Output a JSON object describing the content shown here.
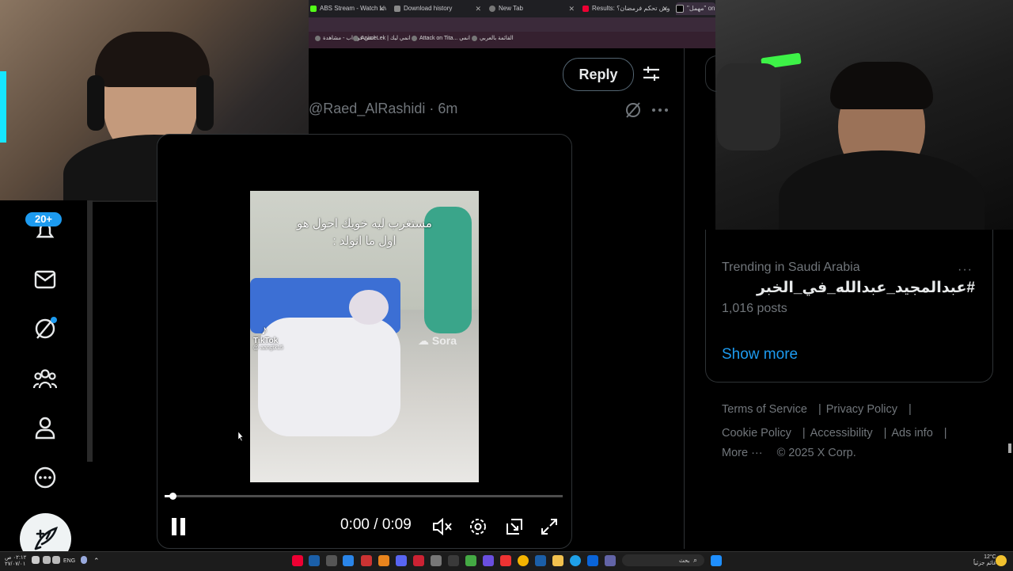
{
  "browser": {
    "tabs": [
      {
        "label": "ABS Stream - Watch Live on K",
        "active": false
      },
      {
        "label": "Download history",
        "active": false
      },
      {
        "label": "New Tab",
        "active": false
      },
      {
        "label": "Results: وش تحكم فرمضان؟ - St",
        "active": false
      },
      {
        "label": "\"مهمل\" on X",
        "active": true
      }
    ],
    "bookmarks": [
      "انمي فور اب - مشاهدة",
      "AnimeLek | انمي ليك",
      "Attack on Tita... انمي",
      "القائمة بالعربي"
    ]
  },
  "left_nav": {
    "badge": "20+",
    "icons": [
      "notifications-icon",
      "messages-icon",
      "grok-icon",
      "communities-icon",
      "profile-icon",
      "more-icon"
    ],
    "compose_icon": "post-compose-icon"
  },
  "post": {
    "reply_label": "Reply",
    "handle": "@Raed_AlRashidi · 6m",
    "video": {
      "overlay_line1": "مستغرب ليه خويك احول هو",
      "overlay_line2": "اول ما انولد :",
      "tiktok_label": "TikTok",
      "tiktok_user": "@ aangtk15",
      "sora_label": "Sora"
    },
    "player": {
      "time": "0:00 / 0:09",
      "progress": 0.02
    }
  },
  "sidebar": {
    "trend_context": "Trending in Saudi Arabia",
    "trend_title": "#عبدالمجيد_عبدالله_في_الخبر",
    "trend_count": "1,016 posts",
    "show_more": "Show more",
    "footer": {
      "terms": "Terms of Service",
      "privacy": "Privacy Policy",
      "cookie": "Cookie Policy",
      "accessibility": "Accessibility",
      "ads": "Ads info",
      "more": "More ···",
      "copyright": "© 2025 X Corp."
    }
  },
  "taskbar": {
    "search_placeholder": "بحث",
    "lang": "ENG",
    "weather_temp": "12°C",
    "weather_text": "غائم جزئياً",
    "clock_time": "٠٢:١٢ ص",
    "clock_date": "٢٧/٠٧/٠١"
  },
  "colors": {
    "accent": "#1d9bf0",
    "background": "#000000",
    "border": "#2f3336",
    "muted_text": "#71767b"
  }
}
